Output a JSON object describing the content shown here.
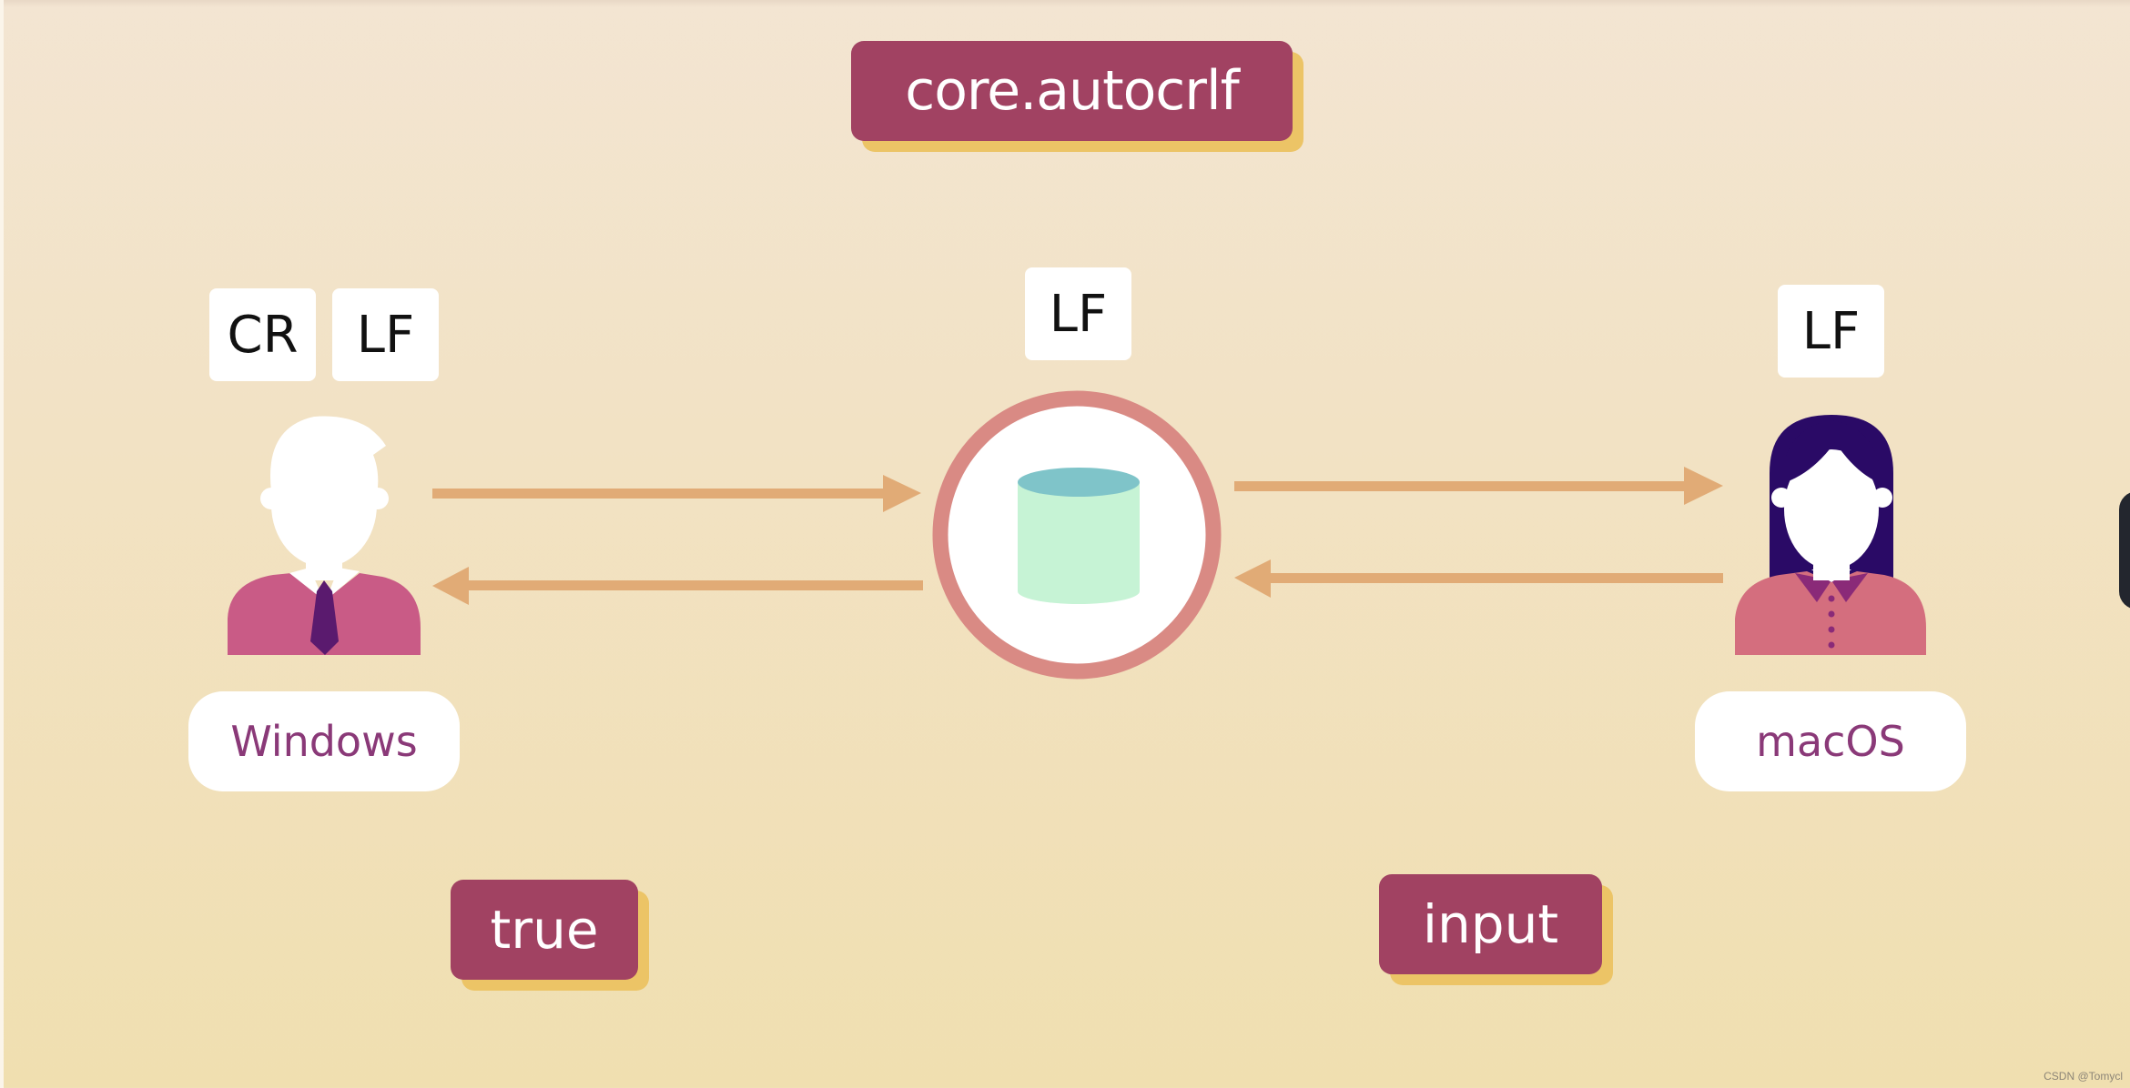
{
  "title": "core.autocrlf",
  "windows": {
    "label": "Windows",
    "line_endings": [
      "CR",
      "LF"
    ],
    "setting_value": "true"
  },
  "repository": {
    "line_endings": [
      "LF"
    ],
    "icon": "database-icon"
  },
  "macos": {
    "label": "macOS",
    "line_endings": [
      "LF"
    ],
    "setting_value": "input"
  },
  "arrows": [
    {
      "from": "windows",
      "to": "repository"
    },
    {
      "from": "repository",
      "to": "windows"
    },
    {
      "from": "repository",
      "to": "macos"
    },
    {
      "from": "macos",
      "to": "repository"
    }
  ],
  "watermark": "CSDN @Tomycl",
  "colors": {
    "tag_bg": "#a14262",
    "tag_shadow": "#ecc466",
    "arrow": "#e1ab76",
    "repo_ring": "#d98a84",
    "db_body": "#c6f3d5",
    "db_top": "#7fc4c9",
    "os_label_text": "#8a3978",
    "man_shirt": "#c95b86",
    "man_tie": "#5a1a6e",
    "woman_hair": "#2a0a66",
    "woman_shirt": "#d46e7e",
    "woman_collar": "#8a2a78"
  }
}
